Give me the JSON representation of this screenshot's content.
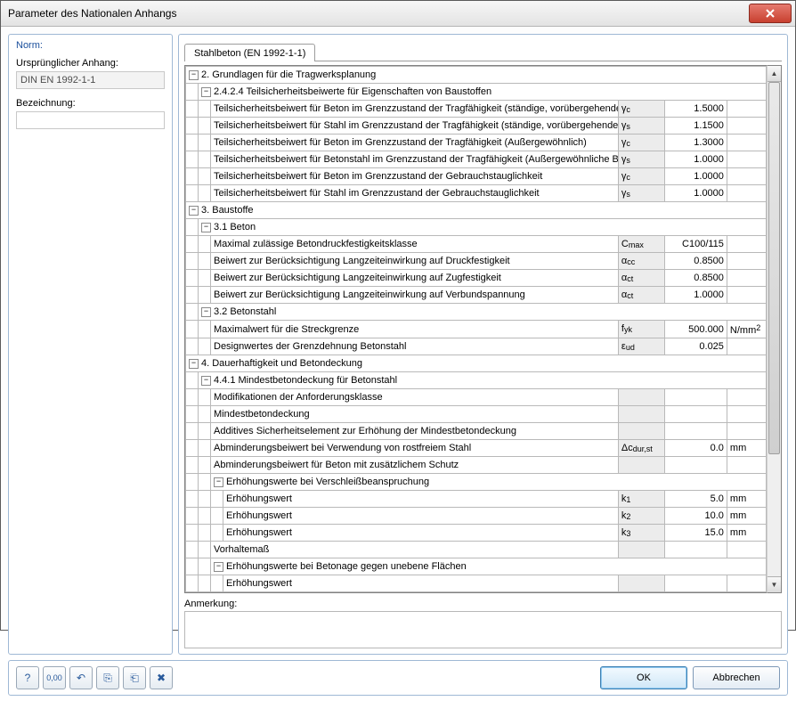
{
  "window": {
    "title": "Parameter des Nationalen Anhangs"
  },
  "left": {
    "heading": "Norm:",
    "orig_label": "Ursprünglicher Anhang:",
    "orig_value": "DIN EN 1992-1-1",
    "desc_label": "Bezeichnung:",
    "desc_value": ""
  },
  "tab": {
    "label": "Stahlbeton (EN 1992-1-1)"
  },
  "remark": {
    "label": "Anmerkung:"
  },
  "buttons": {
    "ok": "OK",
    "cancel": "Abbrechen"
  },
  "icons": {
    "help": "?",
    "num": "0,00",
    "undo": "↶",
    "copy": "⎘",
    "paste": "⎗",
    "del": "✖"
  },
  "tree": {
    "g2": "2. Grundlagen für die Tragwerksplanung",
    "g2_4_2_4": "2.4.2.4 Teilsicherheitsbeiwerte für Eigenschaften von Baustoffen",
    "r1": {
      "t": "Teilsicherheitsbeiwert für Beton im Grenzzustand der Tragfähigkeit (ständige, vorübergehende Bemessungssituation)",
      "s": "γ<sub>c</sub>",
      "v": "1.5000",
      "u": ""
    },
    "r2": {
      "t": "Teilsicherheitsbeiwert für Stahl im Grenzzustand der Tragfähigkeit (ständige, vorübergehende Bemessungssituation)",
      "s": "γ<sub>s</sub>",
      "v": "1.1500",
      "u": ""
    },
    "r3": {
      "t": "Teilsicherheitsbeiwert für Beton im Grenzzustand der Tragfähigkeit (Außergewöhnlich)",
      "s": "γ<sub>c</sub>",
      "v": "1.3000",
      "u": ""
    },
    "r4": {
      "t": "Teilsicherheitsbeiwert für Betonstahl im Grenzzustand der Tragfähigkeit (Außergewöhnliche Bemessungssituation)",
      "s": "γ<sub>s</sub>",
      "v": "1.0000",
      "u": ""
    },
    "r5": {
      "t": "Teilsicherheitsbeiwert für Beton im Grenzzustand der Gebrauchstauglichkeit",
      "s": "γ<sub>c</sub>",
      "v": "1.0000",
      "u": ""
    },
    "r6": {
      "t": "Teilsicherheitsbeiwert für Stahl im Grenzzustand der Gebrauchstauglichkeit",
      "s": "γ<sub>s</sub>",
      "v": "1.0000",
      "u": ""
    },
    "g3": "3. Baustoffe",
    "g3_1": "3.1 Beton",
    "r7": {
      "t": "Maximal zulässige Betondruckfestigkeitsklasse",
      "s": "C<sub>max</sub>",
      "v": "C100/115",
      "u": ""
    },
    "r8": {
      "t": "Beiwert zur Berücksichtigung Langzeiteinwirkung auf Druckfestigkeit",
      "s": "α<sub>cc</sub>",
      "v": "0.8500",
      "u": ""
    },
    "r9": {
      "t": "Beiwert zur Berücksichtigung Langzeiteinwirkung auf Zugfestigkeit",
      "s": "α<sub>ct</sub>",
      "v": "0.8500",
      "u": ""
    },
    "r10": {
      "t": "Beiwert zur Berücksichtigung Langzeiteinwirkung auf Verbundspannung",
      "s": "α<sub>ct</sub>",
      "v": "1.0000",
      "u": ""
    },
    "g3_2": "3.2 Betonstahl",
    "r11": {
      "t": "Maximalwert für die Streckgrenze",
      "s": "f<sub>yk</sub>",
      "v": "500.000",
      "u": "N/mm<sup>2</sup>"
    },
    "r12": {
      "t": "Designwertes der Grenzdehnung Betonstahl",
      "s": "ε<sub>ud</sub>",
      "v": "0.025",
      "u": ""
    },
    "g4": "4. Dauerhaftigkeit und Betondeckung",
    "g4_4_1": "4.4.1 Mindestbetondeckung für Betonstahl",
    "r13": {
      "t": "Modifikationen der Anforderungsklasse",
      "s": "",
      "v": "",
      "u": ""
    },
    "r14": {
      "t": "Mindestbetondeckung",
      "s": "",
      "v": "",
      "u": ""
    },
    "r15": {
      "t": "Additives Sicherheitselement zur Erhöhung der Mindestbetondeckung",
      "s": "",
      "v": "",
      "u": ""
    },
    "r16": {
      "t": "Abminderungsbeiwert bei Verwendung von rostfreiem Stahl",
      "s": "Δc<sub>dur,st</sub>",
      "v": "0.0",
      "u": "mm"
    },
    "r17": {
      "t": "Abminderungsbeiwert für Beton mit zusätzlichem Schutz",
      "s": "",
      "v": "",
      "u": ""
    },
    "gV": "Erhöhungswerte bei Verschleißbeanspruchung",
    "r18": {
      "t": "Erhöhungswert",
      "s": "k<sub>1</sub>",
      "v": "5.0",
      "u": "mm"
    },
    "r19": {
      "t": "Erhöhungswert",
      "s": "k<sub>2</sub>",
      "v": "10.0",
      "u": "mm"
    },
    "r20": {
      "t": "Erhöhungswert",
      "s": "k<sub>3</sub>",
      "v": "15.0",
      "u": "mm"
    },
    "r21": {
      "t": "Vorhaltemaß",
      "s": "",
      "v": "",
      "u": ""
    },
    "gB": "Erhöhungswerte bei Betonage gegen unebene Flächen",
    "r22": {
      "t": "Erhöhungswert",
      "s": "",
      "v": "",
      "u": ""
    }
  }
}
